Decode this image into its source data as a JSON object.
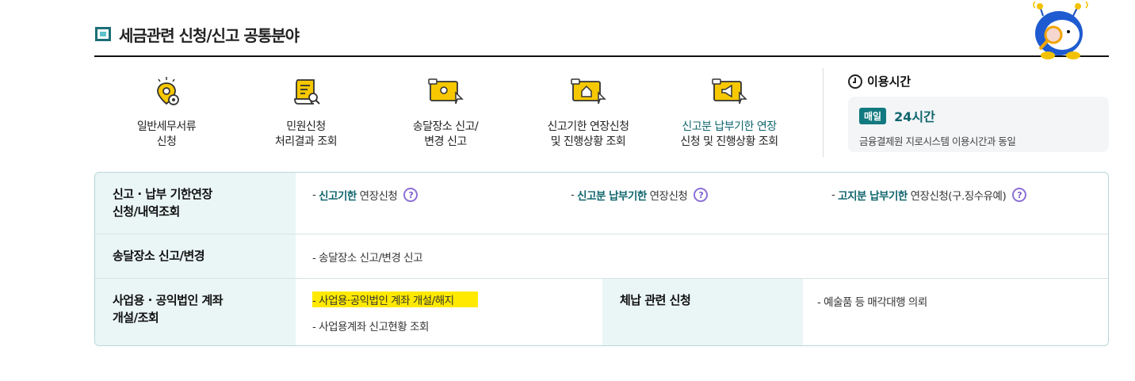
{
  "section": {
    "title": "세금관련 신청/신고 공통분야"
  },
  "services": [
    {
      "line1": "일반세무서류",
      "line2": "신청",
      "icon": "location-gear-icon"
    },
    {
      "line1": "민원신청",
      "line2": "처리결과 조회",
      "icon": "document-search-icon"
    },
    {
      "line1": "송달장소 신고/",
      "line2": "변경 신고",
      "icon": "monitor-location-icon"
    },
    {
      "line1": "신고기한 연장신청",
      "line2": "및 진행상황 조회",
      "icon": "monitor-house-icon"
    },
    {
      "line1": "신고분 납부기한 연장",
      "line2": "신청 및 진행상황 조회",
      "icon": "monitor-megaphone-icon"
    }
  ],
  "hours": {
    "title": "이용시간",
    "badge": "매일",
    "value": "24시간",
    "note": "금융결제원 지로시스템 이용시간과 동일"
  },
  "table": {
    "row1": {
      "header_line1": "신고 · 납부 기한연장",
      "header_line2": "신청/내역조회",
      "links": [
        {
          "dash": "-",
          "highlight": "신고기한",
          "rest": "연장신청"
        },
        {
          "dash": "-",
          "highlight": "신고분 납부기한",
          "rest": "연장신청"
        },
        {
          "dash": "-",
          "highlight": "고지분 납부기한",
          "rest": "연장신청(구.징수유예)"
        }
      ]
    },
    "row2": {
      "header": "송달장소 신고/변경",
      "link": "- 송달장소 신고/변경 신고"
    },
    "row3": {
      "header_line1": "사업용 · 공익법인 계좌",
      "header_line2": "개설/조회",
      "link1": "- 사업용·공익법인 계좌 개설/해지",
      "link2": "- 사업용계좌 신고현황 조회",
      "header2": "체납 관련 신청",
      "link3": "- 예술품 등 매각대행 의뢰"
    }
  },
  "colors": {
    "accent": "#10656d",
    "highlight": "#ffe900",
    "question": "#8b6fd6",
    "header_bg": "#eaf5f6"
  }
}
